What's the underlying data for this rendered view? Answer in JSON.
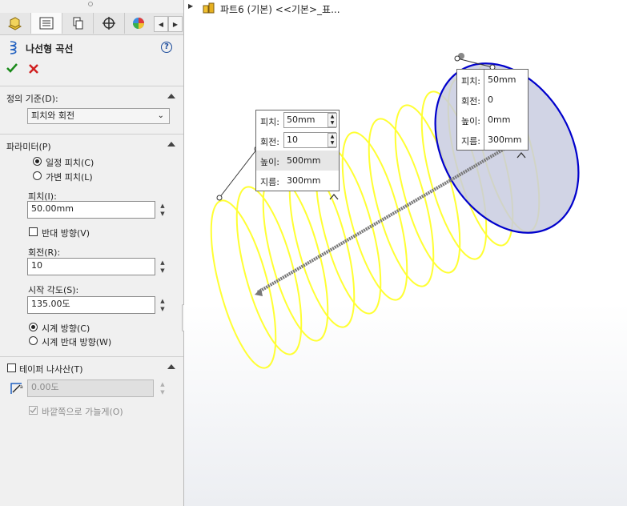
{
  "tree": {
    "name": "파트6 (기본)  <<기본>_표..."
  },
  "panel": {
    "title": "나선형 곡선",
    "definition": {
      "title": "정의 기준(D):",
      "value": "피치와 회전"
    },
    "params": {
      "title": "파라미터(P)",
      "constant_pitch": "일정 피치(C)",
      "variable_pitch": "가변 피치(L)",
      "pitch_label": "피치(I):",
      "pitch_value": "50.00mm",
      "reverse": "반대 방향(V)",
      "revolutions_label": "회전(R):",
      "revolutions_value": "10",
      "start_angle_label": "시작 각도(S):",
      "start_angle_value": "135.00도",
      "clockwise": "시계 방향(C)",
      "counterclockwise": "시계 반대 방향(W)"
    },
    "taper": {
      "title": "테이퍼 나사산(T)",
      "angle_value": "0.00도",
      "outward": "바깥쪽으로 가늘게(O)"
    }
  },
  "callout_left": {
    "rows": [
      {
        "k": "피치:",
        "v": "50mm"
      },
      {
        "k": "회전:",
        "v": "10"
      },
      {
        "k": "높이:",
        "v": "500mm"
      },
      {
        "k": "지름:",
        "v": "300mm"
      }
    ]
  },
  "callout_right": {
    "rows": [
      {
        "k": "피치:",
        "v": "50mm"
      },
      {
        "k": "회전:",
        "v": "0"
      },
      {
        "k": "높이:",
        "v": "0mm"
      },
      {
        "k": "지름:",
        "v": "300mm"
      }
    ]
  },
  "colors": {
    "helix": "#ffff33",
    "circle": "#0000cc",
    "accent": "#1a8a1a"
  }
}
